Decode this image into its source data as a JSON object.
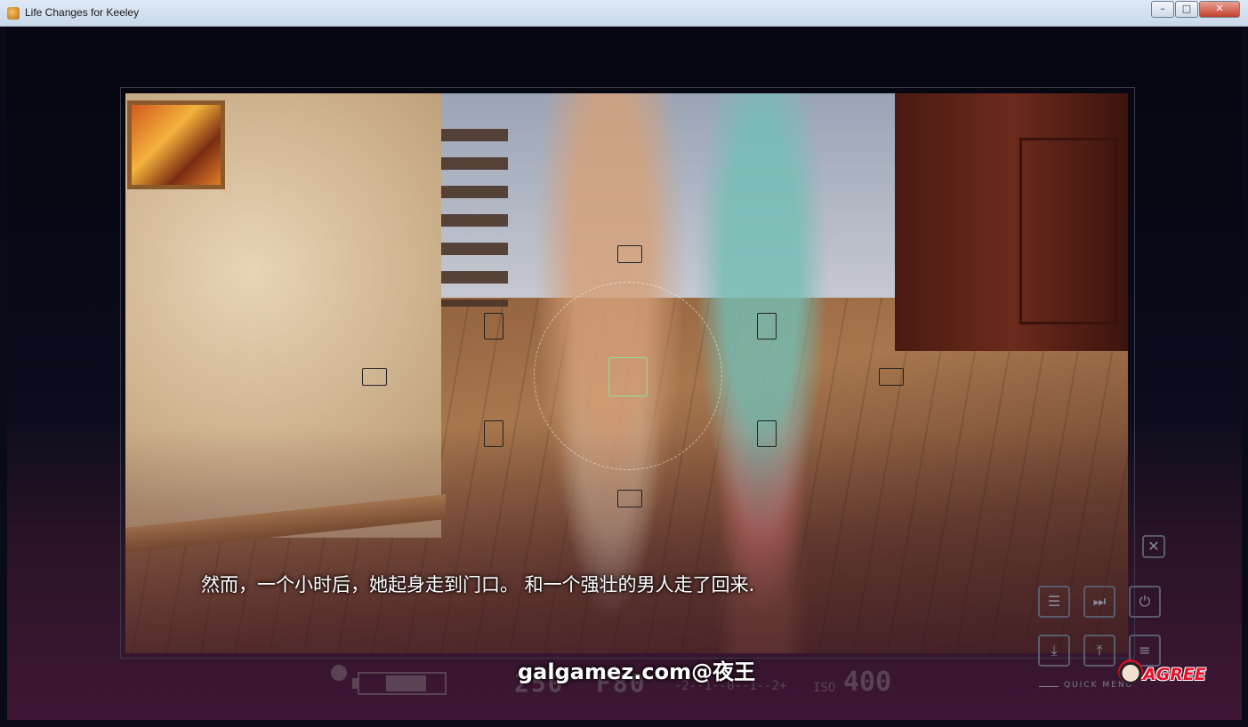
{
  "window": {
    "title": "Life Changes for Keeley",
    "minimize_glyph": "–",
    "maximize_glyph": "□",
    "close_glyph": "✕"
  },
  "dialogue": {
    "text": "然而，一个小时后，她起身走到门口。 和一个强壮的男人走了回来."
  },
  "camera_hud": {
    "shutter": "250",
    "aperture": "F80",
    "exposure_scale": "-2--1--0--1--2+",
    "iso_label": "ISO",
    "iso_value": "400",
    "battery_level": 0.7
  },
  "watermark": "galgamez.com@夜王",
  "quick_menu": {
    "label": "QUICK MENU",
    "close_glyph": "✕",
    "buttons": [
      {
        "name": "history",
        "glyph": "☰"
      },
      {
        "name": "skip",
        "glyph": "⏭"
      },
      {
        "name": "auto",
        "glyph": "⏻"
      },
      {
        "name": "save",
        "glyph": "⤓"
      },
      {
        "name": "load",
        "glyph": "⤒"
      },
      {
        "name": "menu",
        "glyph": "≡"
      }
    ]
  },
  "logo": {
    "text": "AGREE"
  }
}
